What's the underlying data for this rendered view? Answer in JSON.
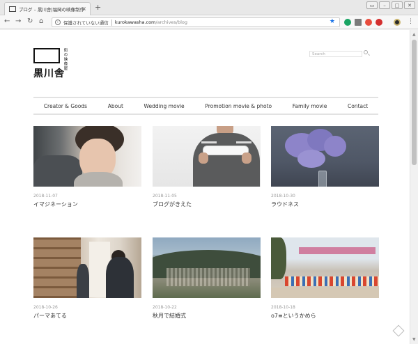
{
  "browser": {
    "tab_title": "ブログ – 黒川舎|福岡の映像制作",
    "tab_close": "×",
    "new_tab": "+",
    "security_label": "保護されていない通信",
    "url_host": "kurokawasha.com",
    "url_path": "/archives/blog",
    "star": "★",
    "menu": "⋮",
    "extension_colors": [
      "#19a463",
      "#7a7a7a",
      "#e84c3d",
      "#d32f2f"
    ],
    "account_color": "#2a2a2a"
  },
  "site": {
    "logo_sub": "街の映像屋",
    "logo_name": "黒川舎",
    "search_placeholder": "Search"
  },
  "nav": {
    "items": [
      "Creator & Goods",
      "About",
      "Wedding movie",
      "Promotion movie & photo",
      "Family movie",
      "Contact"
    ]
  },
  "posts": [
    {
      "date": "2018-11-07",
      "title": "イマジネーション"
    },
    {
      "date": "2018-11-05",
      "title": "ブログがきえた"
    },
    {
      "date": "2018-10-30",
      "title": "ラウドネス"
    },
    {
      "date": "2018-10-26",
      "title": "パーマあてる"
    },
    {
      "date": "2018-10-22",
      "title": "秋月で結婚式"
    },
    {
      "date": "2018-10-18",
      "title": "o7≡というかめら"
    }
  ]
}
